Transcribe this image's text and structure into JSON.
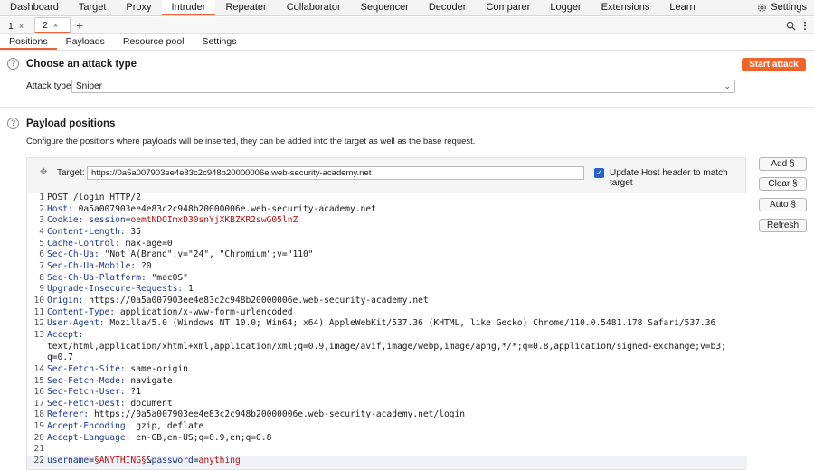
{
  "menu": {
    "items": [
      "Dashboard",
      "Target",
      "Proxy",
      "Intruder",
      "Repeater",
      "Collaborator",
      "Sequencer",
      "Decoder",
      "Comparer",
      "Logger",
      "Extensions",
      "Learn"
    ],
    "active": "Intruder",
    "settings_label": "Settings"
  },
  "tabs": {
    "items": [
      {
        "label": "1"
      },
      {
        "label": "2"
      }
    ],
    "close_glyph": "×",
    "add_glyph": "+"
  },
  "section_tabs": {
    "items": [
      "Positions",
      "Payloads",
      "Resource pool",
      "Settings"
    ],
    "active": "Positions"
  },
  "attack": {
    "title": "Choose an attack type",
    "start_label": "Start attack",
    "type_label": "Attack type:",
    "type_value": "Sniper"
  },
  "positions": {
    "title": "Payload positions",
    "description": "Configure the positions where payloads will be inserted, they can be added into the target as well as the base request.",
    "target_label": "Target:",
    "target_value": "https://0a5a007903ee4e83c2c948b20000006e.web-security-academy.net",
    "update_host_label": "Update Host header to match target",
    "update_host_checked": true,
    "buttons": {
      "add": "Add §",
      "clear": "Clear §",
      "auto": "Auto §",
      "refresh": "Refresh"
    }
  },
  "request": {
    "lines": [
      {
        "n": "1",
        "parts": [
          {
            "t": "POST /login HTTP/2",
            "c": ""
          }
        ]
      },
      {
        "n": "2",
        "parts": [
          {
            "t": "Host: ",
            "c": "hname"
          },
          {
            "t": "0a5a007903ee4e83c2c948b20000006e.web-security-academy.net",
            "c": ""
          }
        ]
      },
      {
        "n": "3",
        "parts": [
          {
            "t": "Cookie: ",
            "c": "hname"
          },
          {
            "t": "session",
            "c": "hname"
          },
          {
            "t": "=",
            "c": ""
          },
          {
            "t": "oemtNDOImxD30snYjXKBZKR2swG05lnZ",
            "c": "ck"
          }
        ]
      },
      {
        "n": "4",
        "parts": [
          {
            "t": "Content-Length: ",
            "c": "hname"
          },
          {
            "t": "35",
            "c": ""
          }
        ]
      },
      {
        "n": "5",
        "parts": [
          {
            "t": "Cache-Control: ",
            "c": "hname"
          },
          {
            "t": "max-age=0",
            "c": ""
          }
        ]
      },
      {
        "n": "6",
        "parts": [
          {
            "t": "Sec-Ch-Ua: ",
            "c": "hname"
          },
          {
            "t": "\"Not A(Brand\";v=\"24\", \"Chromium\";v=\"110\"",
            "c": ""
          }
        ]
      },
      {
        "n": "7",
        "parts": [
          {
            "t": "Sec-Ch-Ua-Mobile: ",
            "c": "hname"
          },
          {
            "t": "?0",
            "c": ""
          }
        ]
      },
      {
        "n": "8",
        "parts": [
          {
            "t": "Sec-Ch-Ua-Platform: ",
            "c": "hname"
          },
          {
            "t": "\"macOS\"",
            "c": ""
          }
        ]
      },
      {
        "n": "9",
        "parts": [
          {
            "t": "Upgrade-Insecure-Requests: ",
            "c": "hname"
          },
          {
            "t": "1",
            "c": ""
          }
        ]
      },
      {
        "n": "10",
        "parts": [
          {
            "t": "Origin: ",
            "c": "hname"
          },
          {
            "t": "https://0a5a007903ee4e83c2c948b20000006e.web-security-academy.net",
            "c": ""
          }
        ]
      },
      {
        "n": "11",
        "parts": [
          {
            "t": "Content-Type: ",
            "c": "hname"
          },
          {
            "t": "application/x-www-form-urlencoded",
            "c": ""
          }
        ]
      },
      {
        "n": "12",
        "parts": [
          {
            "t": "User-Agent: ",
            "c": "hname"
          },
          {
            "t": "Mozilla/5.0 (Windows NT 10.0; Win64; x64) AppleWebKit/537.36 (KHTML, like Gecko) Chrome/110.0.5481.178 Safari/537.36",
            "c": ""
          }
        ]
      },
      {
        "n": "13",
        "parts": [
          {
            "t": "Accept:",
            "c": "hname"
          }
        ]
      },
      {
        "n": "",
        "parts": [
          {
            "t": "text/html,application/xhtml+xml,application/xml;q=0.9,image/avif,image/webp,image/apng,*/*;q=0.8,application/signed-exchange;v=b3;",
            "c": ""
          }
        ]
      },
      {
        "n": "",
        "parts": [
          {
            "t": "q=0.7",
            "c": ""
          }
        ]
      },
      {
        "n": "14",
        "parts": [
          {
            "t": "Sec-Fetch-Site: ",
            "c": "hname"
          },
          {
            "t": "same-origin",
            "c": ""
          }
        ]
      },
      {
        "n": "15",
        "parts": [
          {
            "t": "Sec-Fetch-Mode: ",
            "c": "hname"
          },
          {
            "t": "navigate",
            "c": ""
          }
        ]
      },
      {
        "n": "16",
        "parts": [
          {
            "t": "Sec-Fetch-User: ",
            "c": "hname"
          },
          {
            "t": "?1",
            "c": ""
          }
        ]
      },
      {
        "n": "17",
        "parts": [
          {
            "t": "Sec-Fetch-Dest: ",
            "c": "hname"
          },
          {
            "t": "document",
            "c": ""
          }
        ]
      },
      {
        "n": "18",
        "parts": [
          {
            "t": "Referer: ",
            "c": "hname"
          },
          {
            "t": "https://0a5a007903ee4e83c2c948b20000006e.web-security-academy.net/login",
            "c": ""
          }
        ]
      },
      {
        "n": "19",
        "parts": [
          {
            "t": "Accept-Encoding: ",
            "c": "hname"
          },
          {
            "t": "gzip, deflate",
            "c": ""
          }
        ]
      },
      {
        "n": "20",
        "parts": [
          {
            "t": "Accept-Language: ",
            "c": "hname"
          },
          {
            "t": "en-GB,en-US;q=0.9,en;q=0.8",
            "c": ""
          }
        ]
      },
      {
        "n": "21",
        "parts": []
      },
      {
        "n": "22",
        "parts": [
          {
            "t": "username",
            "c": "hname"
          },
          {
            "t": "=",
            "c": ""
          },
          {
            "t": "§ANYTHING§",
            "c": "pm"
          },
          {
            "t": "&",
            "c": ""
          },
          {
            "t": "password",
            "c": "hname"
          },
          {
            "t": "=",
            "c": ""
          },
          {
            "t": "anything",
            "c": "pm"
          }
        ],
        "hl": true
      }
    ]
  },
  "colors": {
    "accent": "#e8663a",
    "start_button": "#f0632b",
    "header_name": "#1e3a8a",
    "value_red": "#b31212"
  }
}
